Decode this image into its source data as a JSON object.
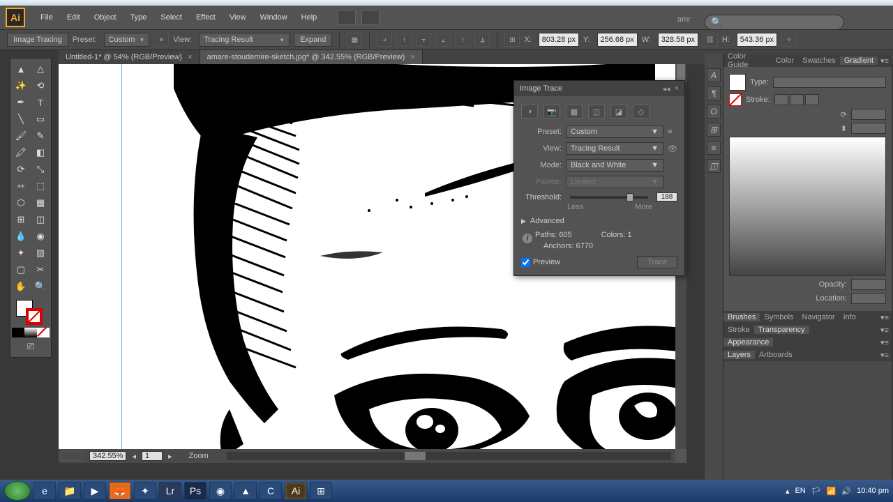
{
  "menus": {
    "file": "File",
    "edit": "Edit",
    "object": "Object",
    "type": "Type",
    "select": "Select",
    "effect": "Effect",
    "view": "View",
    "window": "Window",
    "help": "Help"
  },
  "user": "amr",
  "controlbar": {
    "title": "Image Tracing",
    "preset_label": "Preset:",
    "preset_value": "Custom",
    "view_label": "View:",
    "view_value": "Tracing Result",
    "expand": "Expand",
    "x_label": "X:",
    "x": "803.28 px",
    "y_label": "Y:",
    "y": "256.68 px",
    "w_label": "W:",
    "w": "328.58 px",
    "h_label": "H:",
    "h": "543.36 px"
  },
  "tabs": [
    {
      "label": "Untitled-1* @ 54% (RGB/Preview)"
    },
    {
      "label": "amare-stoudemire-sketch.jpg* @ 342.55% (RGB/Preview)"
    }
  ],
  "trace": {
    "title": "Image Trace",
    "preset_l": "Preset:",
    "preset": "Custom",
    "view_l": "View:",
    "view": "Tracing Result",
    "mode_l": "Mode:",
    "mode": "Black and White",
    "palette_l": "Palette:",
    "palette": "Limited",
    "threshold_l": "Threshold:",
    "threshold": "188",
    "less": "Less",
    "more": "More",
    "advanced": "Advanced",
    "paths_l": "Paths:",
    "paths": "605",
    "colors_l": "Colors:",
    "colors": "1",
    "anchors_l": "Anchors:",
    "anchors": "6770",
    "preview": "Preview",
    "trace_btn": "Trace"
  },
  "right": {
    "tabs1": {
      "colorguide": "Color Guide",
      "color": "Color",
      "swatches": "Swatches",
      "gradient": "Gradient"
    },
    "type_l": "Type:",
    "stroke_l": "Stroke:",
    "opacity_l": "Opacity:",
    "location_l": "Location:",
    "tabs2": {
      "brushes": "Brushes",
      "symbols": "Symbols",
      "navigator": "Navigator",
      "info": "Info"
    },
    "tabs3": {
      "stroke": "Stroke",
      "transparency": "Transparency"
    },
    "tabs4": {
      "appearance": "Appearance"
    },
    "tabs5": {
      "layers": "Layers",
      "artboards": "Artboards"
    }
  },
  "status": {
    "zoom": "342.55%",
    "page": "1",
    "zoom_label": "Zoom"
  },
  "tray": {
    "lang": "EN",
    "time": "10:40 pm"
  }
}
